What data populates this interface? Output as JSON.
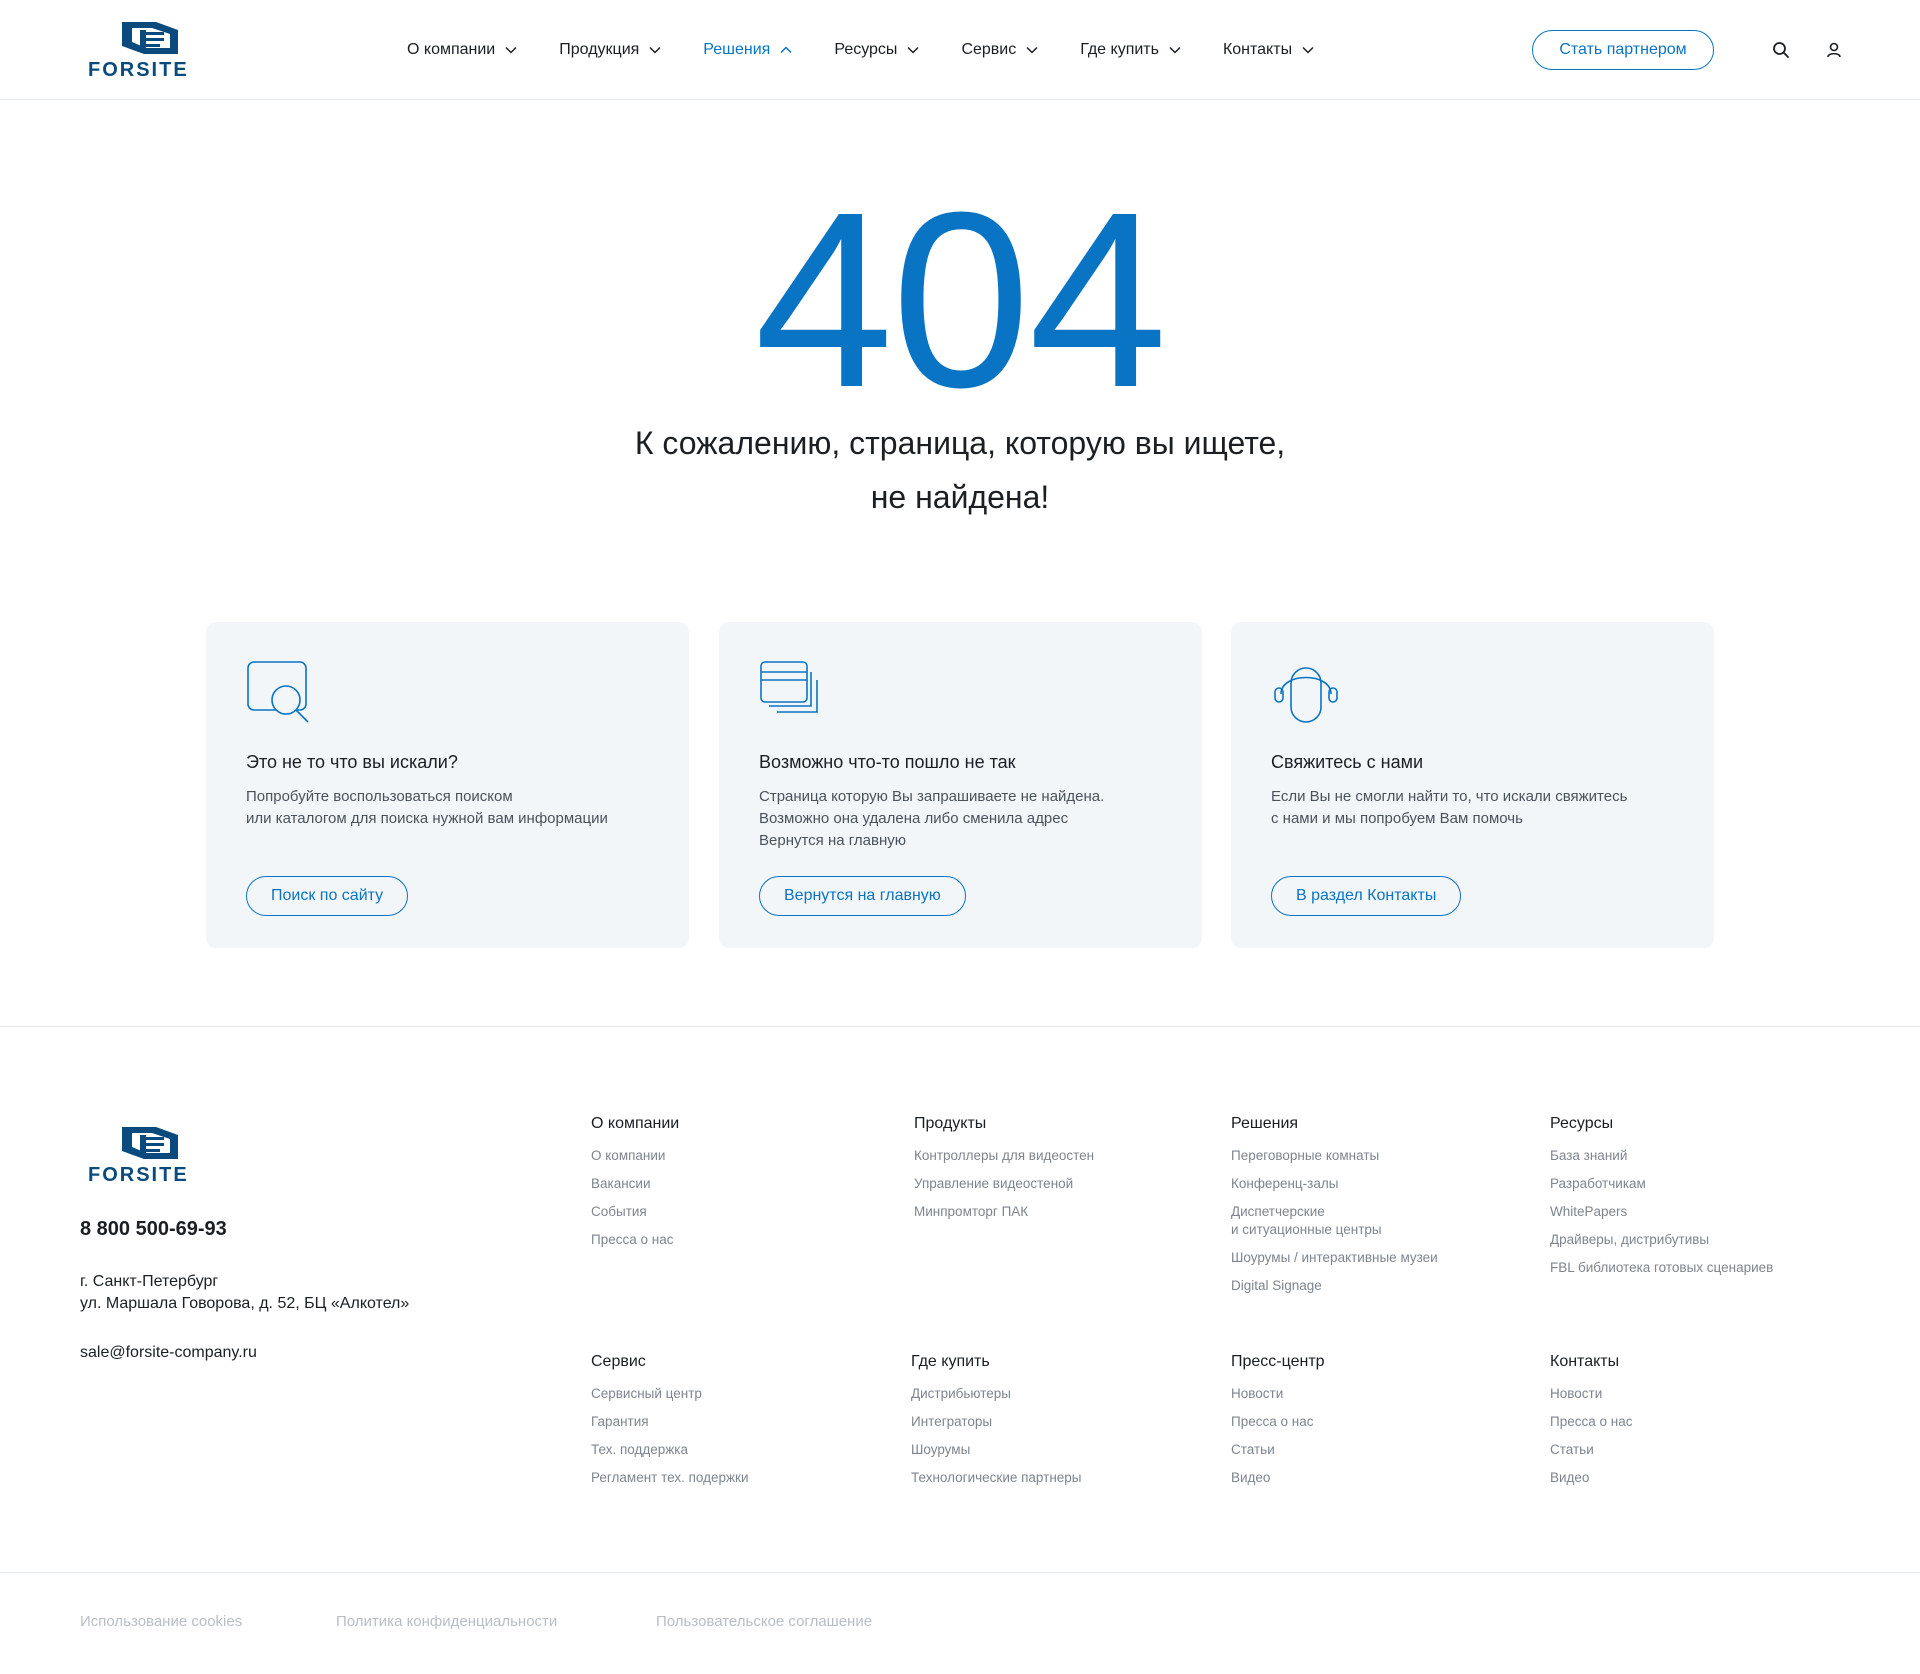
{
  "brand": {
    "name": "FORSITE",
    "color": "#0b4a7d"
  },
  "accent_color": "#0a74c4",
  "nav": {
    "items": [
      {
        "label": "О компании",
        "active": false
      },
      {
        "label": "Продукция",
        "active": false
      },
      {
        "label": "Решения",
        "active": true
      },
      {
        "label": "Ресурсы",
        "active": false
      },
      {
        "label": "Сервис",
        "active": false
      },
      {
        "label": "Где купить",
        "active": false
      },
      {
        "label": "Контакты",
        "active": false
      }
    ],
    "partner_button": "Стать партнером",
    "icons": [
      "search-icon",
      "user-icon"
    ]
  },
  "error": {
    "code": "404",
    "message_line1": "К сожалению, страница, которую вы ищете,",
    "message_line2": "не найдена!"
  },
  "cards": [
    {
      "icon": "search-window-icon",
      "title": "Это не то что вы искали?",
      "text": "Попробуйте воспользоваться поиском\nили каталогом для поиска нужной вам информации",
      "button": "Поиск по сайту"
    },
    {
      "icon": "browser-windows-icon",
      "title": "Возможно что-то пошло не так",
      "text": "Страница которую Вы запрашиваете не найдена.\nВозможно она удалена либо сменила адрес\nВернутся на главную",
      "button": "Вернутся на главную"
    },
    {
      "icon": "headset-icon",
      "title": "Свяжитесь с нами",
      "text": "Если Вы не смогли найти то, что искали свяжитесь\nс нами и мы попробуем Вам помочь",
      "button": "В раздел Контакты"
    }
  ],
  "footer": {
    "phone": "8 800 500-69-93",
    "address_line1": "г. Санкт-Петербург",
    "address_line2": "ул. Маршала Говорова, д. 52, БЦ «Алкотел»",
    "email": "sale@forsite-company.ru",
    "columns": [
      {
        "title": "О компании",
        "links": [
          "О компании",
          "Вакансии",
          "События",
          "Пресса о нас"
        ]
      },
      {
        "title": "Продукты",
        "links": [
          "Контроллеры для видеостен",
          "Управление видеостеной",
          "Минпромторг ПАК"
        ]
      },
      {
        "title": "Решения",
        "links": [
          "Переговорные комнаты",
          "Конференц-залы",
          "Диспетчерские\nи ситуационные центры",
          "Шоурумы / интерактивные музеи",
          "Digital Signage"
        ]
      },
      {
        "title": "Ресурсы",
        "links": [
          "База знаний",
          "Разработчикам",
          "WhitePapers",
          "Драйверы, дистрибутивы",
          "FBL библиотека готовых сценариев"
        ]
      },
      {
        "title": "Сервис",
        "links": [
          "Сервисный центр",
          "Гарантия",
          "Тех. поддержка",
          "Регламент тех. подержки"
        ]
      },
      {
        "title": "Где купить",
        "links": [
          "Дистрибьютеры",
          "Интеграторы",
          "Шоурумы",
          "Технологические партнеры"
        ]
      },
      {
        "title": "Пресс-центр",
        "links": [
          "Новости",
          "Пресса о нас",
          "Статьи",
          "Видео"
        ]
      },
      {
        "title": "Контакты",
        "links": [
          "Новости",
          "Пресса о нас",
          "Статьи",
          "Видео"
        ]
      }
    ],
    "legal": [
      "Использование cookies",
      "Политика конфиденциальности",
      "Пользовательское соглашение"
    ]
  }
}
